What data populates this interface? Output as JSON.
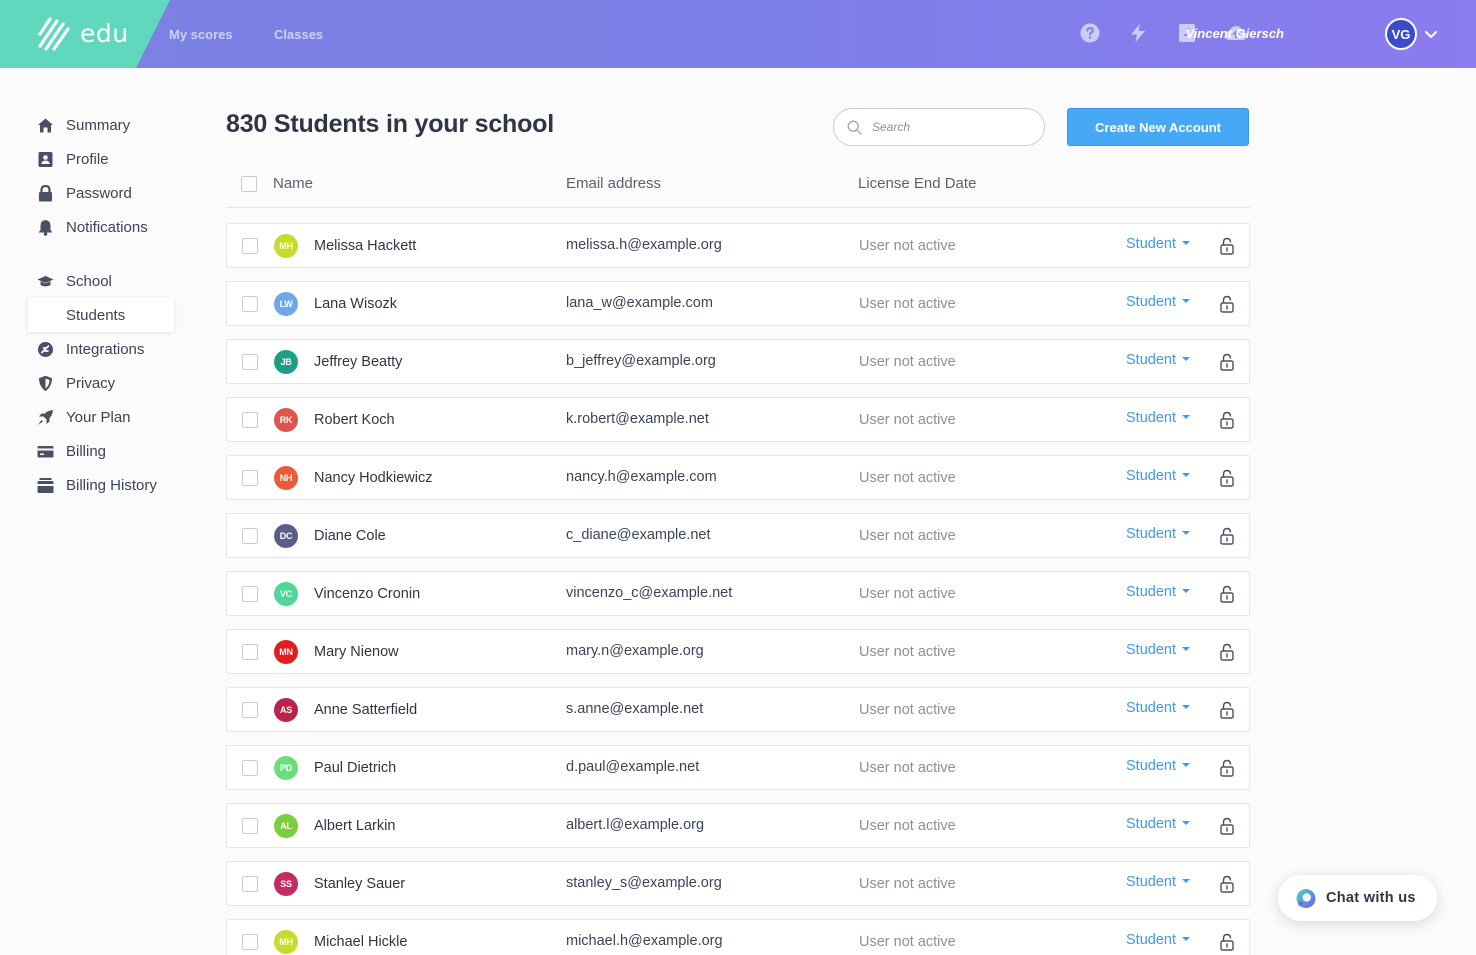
{
  "brand": {
    "name": "edu",
    "color": "#5fd8bd"
  },
  "topnav": {
    "links": [
      "My scores",
      "Classes"
    ],
    "icons": [
      "help-icon",
      "bolt-icon",
      "book-icon",
      "cloud-upload-icon"
    ],
    "user_name": "Vincent Giersch",
    "user_initials": "VG"
  },
  "sidebar": {
    "items": [
      {
        "label": "Summary",
        "icon": "home-icon"
      },
      {
        "label": "Profile",
        "icon": "id-card-icon"
      },
      {
        "label": "Password",
        "icon": "lock-icon"
      },
      {
        "label": "Notifications",
        "icon": "bell-icon"
      },
      {
        "label": "School",
        "icon": "graduation-cap-icon"
      },
      {
        "label": "Students",
        "icon": "",
        "active": true
      },
      {
        "label": "Integrations",
        "icon": "puzzle-icon"
      },
      {
        "label": "Privacy",
        "icon": "shield-icon"
      },
      {
        "label": "Your Plan",
        "icon": "rocket-icon"
      },
      {
        "label": "Billing",
        "icon": "credit-card-icon"
      },
      {
        "label": "Billing History",
        "icon": "receipt-icon"
      }
    ]
  },
  "main": {
    "title": "830 Students in your school",
    "search_placeholder": "Search",
    "create_button": "Create New Account",
    "columns": {
      "name": "Name",
      "email": "Email address",
      "license": "License End Date"
    },
    "accent": "#47a8f5",
    "rows": [
      {
        "initials": "MH",
        "name": "Melissa Hackett",
        "email": "melissa.h@example.org",
        "status": "User not active",
        "role": "Student",
        "color": "#c6dc2c"
      },
      {
        "initials": "LW",
        "name": "Lana Wisozk",
        "email": "lana_w@example.com",
        "status": "User not active",
        "role": "Student",
        "color": "#6fa8e8"
      },
      {
        "initials": "JB",
        "name": "Jeffrey Beatty",
        "email": "b_jeffrey@example.org",
        "status": "User not active",
        "role": "Student",
        "color": "#1f9e86"
      },
      {
        "initials": "RK",
        "name": "Robert Koch",
        "email": "k.robert@example.net",
        "status": "User not active",
        "role": "Student",
        "color": "#e0554b"
      },
      {
        "initials": "NH",
        "name": "Nancy Hodkiewicz",
        "email": "nancy.h@example.com",
        "status": "User not active",
        "role": "Student",
        "color": "#ea5a3c"
      },
      {
        "initials": "DC",
        "name": "Diane Cole",
        "email": "c_diane@example.net",
        "status": "User not active",
        "role": "Student",
        "color": "#5a5f8a"
      },
      {
        "initials": "VC",
        "name": "Vincenzo Cronin",
        "email": "vincenzo_c@example.net",
        "status": "User not active",
        "role": "Student",
        "color": "#4fd69a"
      },
      {
        "initials": "MN",
        "name": "Mary Nienow",
        "email": "mary.n@example.org",
        "status": "User not active",
        "role": "Student",
        "color": "#e21d1d"
      },
      {
        "initials": "AS",
        "name": "Anne Satterfield",
        "email": "s.anne@example.net",
        "status": "User not active",
        "role": "Student",
        "color": "#b8244a"
      },
      {
        "initials": "PD",
        "name": "Paul Dietrich",
        "email": "d.paul@example.net",
        "status": "User not active",
        "role": "Student",
        "color": "#6bde7c"
      },
      {
        "initials": "AL",
        "name": "Albert Larkin",
        "email": "albert.l@example.org",
        "status": "User not active",
        "role": "Student",
        "color": "#7ccf3a"
      },
      {
        "initials": "SS",
        "name": "Stanley Sauer",
        "email": "stanley_s@example.org",
        "status": "User not active",
        "role": "Student",
        "color": "#c42a63"
      },
      {
        "initials": "MH",
        "name": "Michael Hickle",
        "email": "michael.h@example.org",
        "status": "User not active",
        "role": "Student",
        "color": "#c6dc2c"
      }
    ]
  },
  "chat": {
    "label": "Chat with us"
  }
}
